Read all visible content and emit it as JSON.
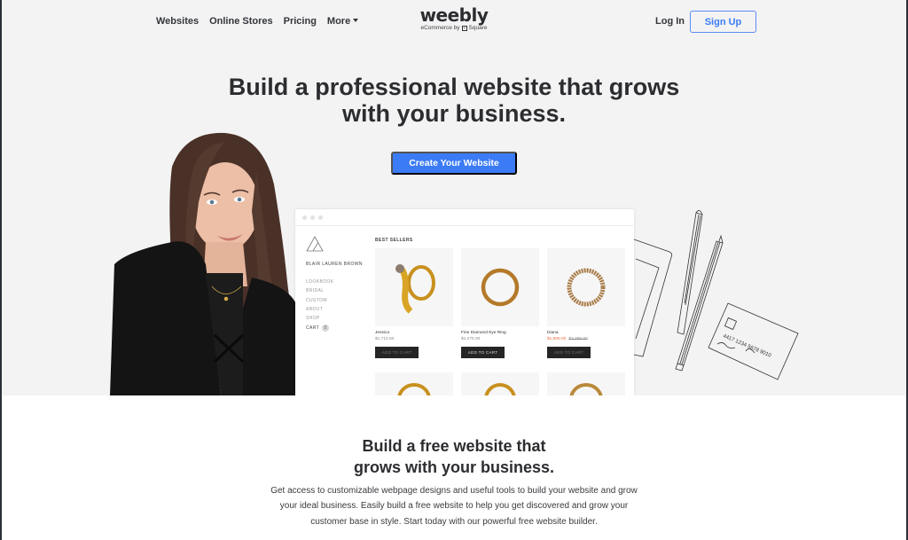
{
  "nav": {
    "links": [
      "Websites",
      "Online Stores",
      "Pricing",
      "More"
    ],
    "logo_word": "weebly",
    "logo_sub_prefix": "eCommerce by",
    "logo_sub_brand": "Square",
    "login": "Log In",
    "signup": "Sign Up"
  },
  "hero": {
    "title_line1": "Build a professional website that grows",
    "title_line2": "with your business.",
    "cta": "Create Your Website",
    "accent_color": "#3b7bf6"
  },
  "mockup": {
    "brand": "BLAIR LAUREN BROWN",
    "menu": [
      "LOOKBOOK",
      "BRIDAL",
      "CUSTOM",
      "ABOUT",
      "SHOP",
      "CART"
    ],
    "cart_count": "0",
    "section_title": "BEST SELLERS",
    "products": [
      {
        "name": "Jessica",
        "price": "$1,712.50",
        "sale_price": "",
        "button": "ADD TO CART"
      },
      {
        "name": "Fine Diamond Eye Ring",
        "price": "$1,275.00",
        "sale_price": "",
        "button": "ADD TO CART"
      },
      {
        "name": "Diana",
        "price": "$2,295.00",
        "sale_price": "$1,900.00",
        "button": "ADD TO CART"
      }
    ]
  },
  "card_sketch": {
    "number": "4417 1234 5678 9010"
  },
  "section2": {
    "title_line1": "Build a free website that",
    "title_line2": "grows with your business.",
    "body": "Get access to customizable webpage designs and useful tools to build your website and grow your ideal business. Easily build a free website to help you get discovered and grow your customer base in style. Start today with our powerful free website builder."
  }
}
